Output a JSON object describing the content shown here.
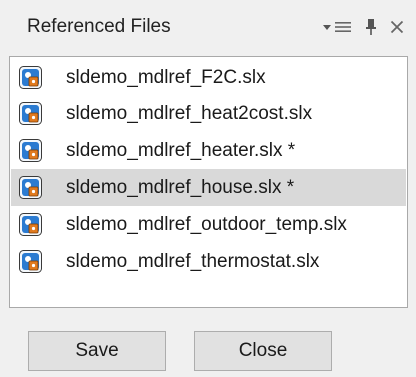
{
  "panel": {
    "title": "Referenced Files",
    "menu_glyph": "▾≡",
    "close_glyph": "✕"
  },
  "files": [
    {
      "name": "sldemo_mdlref_F2C.slx",
      "selected": false,
      "icon": "simulink-model-icon"
    },
    {
      "name": "sldemo_mdlref_heat2cost.slx",
      "selected": false,
      "icon": "simulink-model-icon"
    },
    {
      "name": "sldemo_mdlref_heater.slx *",
      "selected": false,
      "icon": "simulink-model-icon"
    },
    {
      "name": "sldemo_mdlref_house.slx *",
      "selected": true,
      "icon": "simulink-model-icon"
    },
    {
      "name": "sldemo_mdlref_outdoor_temp.slx",
      "selected": false,
      "icon": "simulink-model-icon"
    },
    {
      "name": "sldemo_mdlref_thermostat.slx",
      "selected": false,
      "icon": "simulink-model-icon"
    }
  ],
  "buttons": {
    "save_label": "Save",
    "close_label": "Close"
  },
  "colors": {
    "panel_bg": "#f0f0f0",
    "selection_bg": "#d9d9d9",
    "icon_blue": "#2b7bd1",
    "icon_orange": "#e07a1f"
  }
}
